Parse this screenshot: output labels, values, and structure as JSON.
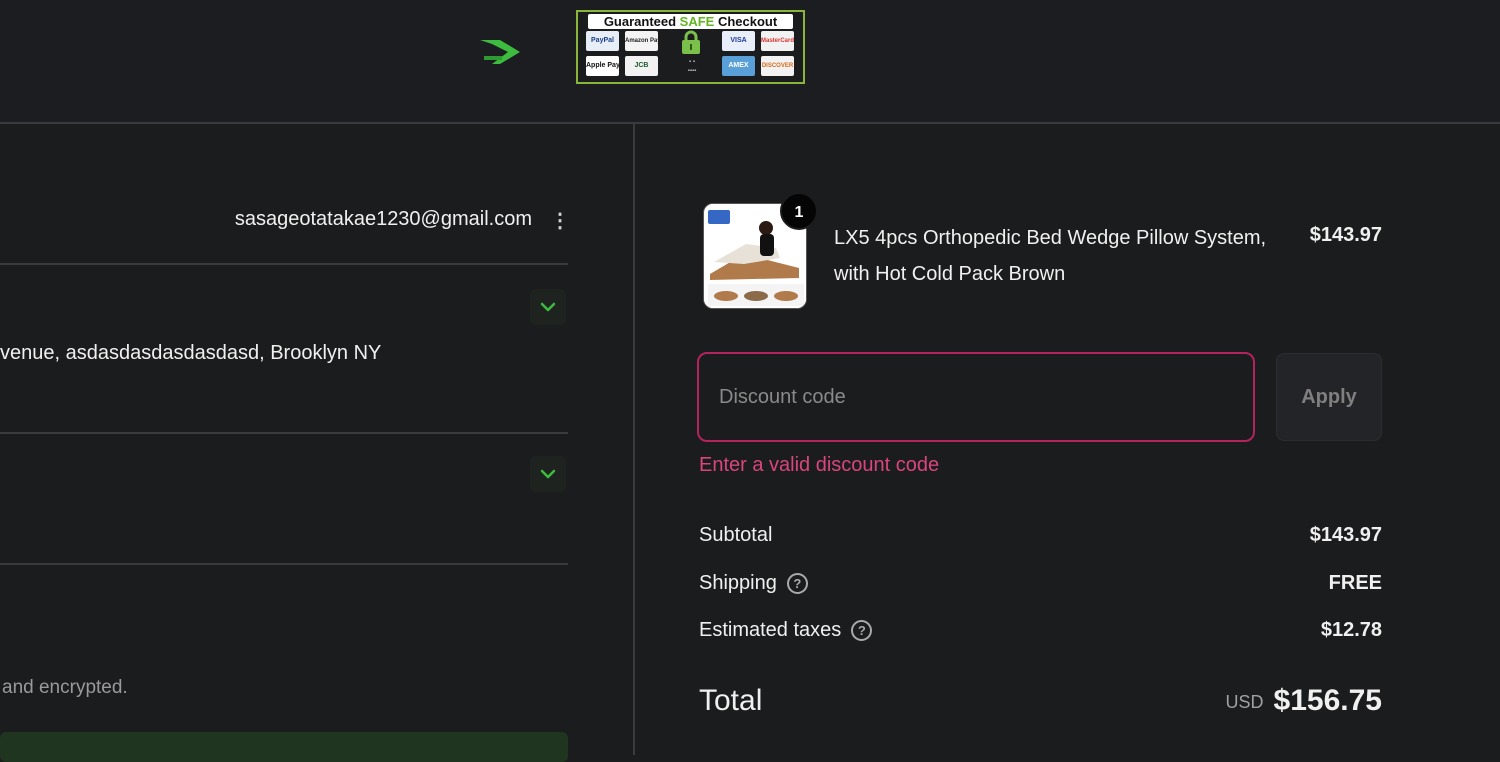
{
  "header": {
    "badge_title_prefix": "Guaranteed ",
    "badge_title_safe": "SAFE",
    "badge_title_suffix": " Checkout",
    "payment_methods": [
      "PayPal",
      "Amazon Pay",
      "VISA",
      "MasterCard",
      "Apple Pay",
      "JCB",
      "AMEX",
      "DISCOVER"
    ],
    "colors": {
      "brand_accent": "#3dbb3f",
      "badge_border": "#8ab43a"
    }
  },
  "contact": {
    "email": "sasageotatakae1230@gmail.com",
    "menu_icon": "kebab-menu-icon"
  },
  "shipping": {
    "address": "venue, asdasdasdasdasdasd, Brooklyn NY",
    "expand_icon": "chevron-down-icon"
  },
  "payment": {
    "expand_icon": "chevron-down-icon",
    "secure_note": "and encrypted."
  },
  "cart": {
    "item": {
      "quantity": "1",
      "name": "LX5 4pcs Orthopedic Bed Wedge Pillow System, with Hot Cold Pack Brown",
      "price": "$143.97"
    }
  },
  "discount": {
    "placeholder": "Discount code",
    "apply_label": "Apply",
    "error": "Enter a valid discount code",
    "error_color": "#d9457c"
  },
  "summary": {
    "subtotal_label": "Subtotal",
    "subtotal_value": "$143.97",
    "shipping_label": "Shipping",
    "shipping_value": "FREE",
    "taxes_label": "Estimated taxes",
    "taxes_value": "$12.78",
    "help_icon": "question-circle-icon",
    "total_label": "Total",
    "total_currency": "USD",
    "total_value": "$156.75"
  }
}
